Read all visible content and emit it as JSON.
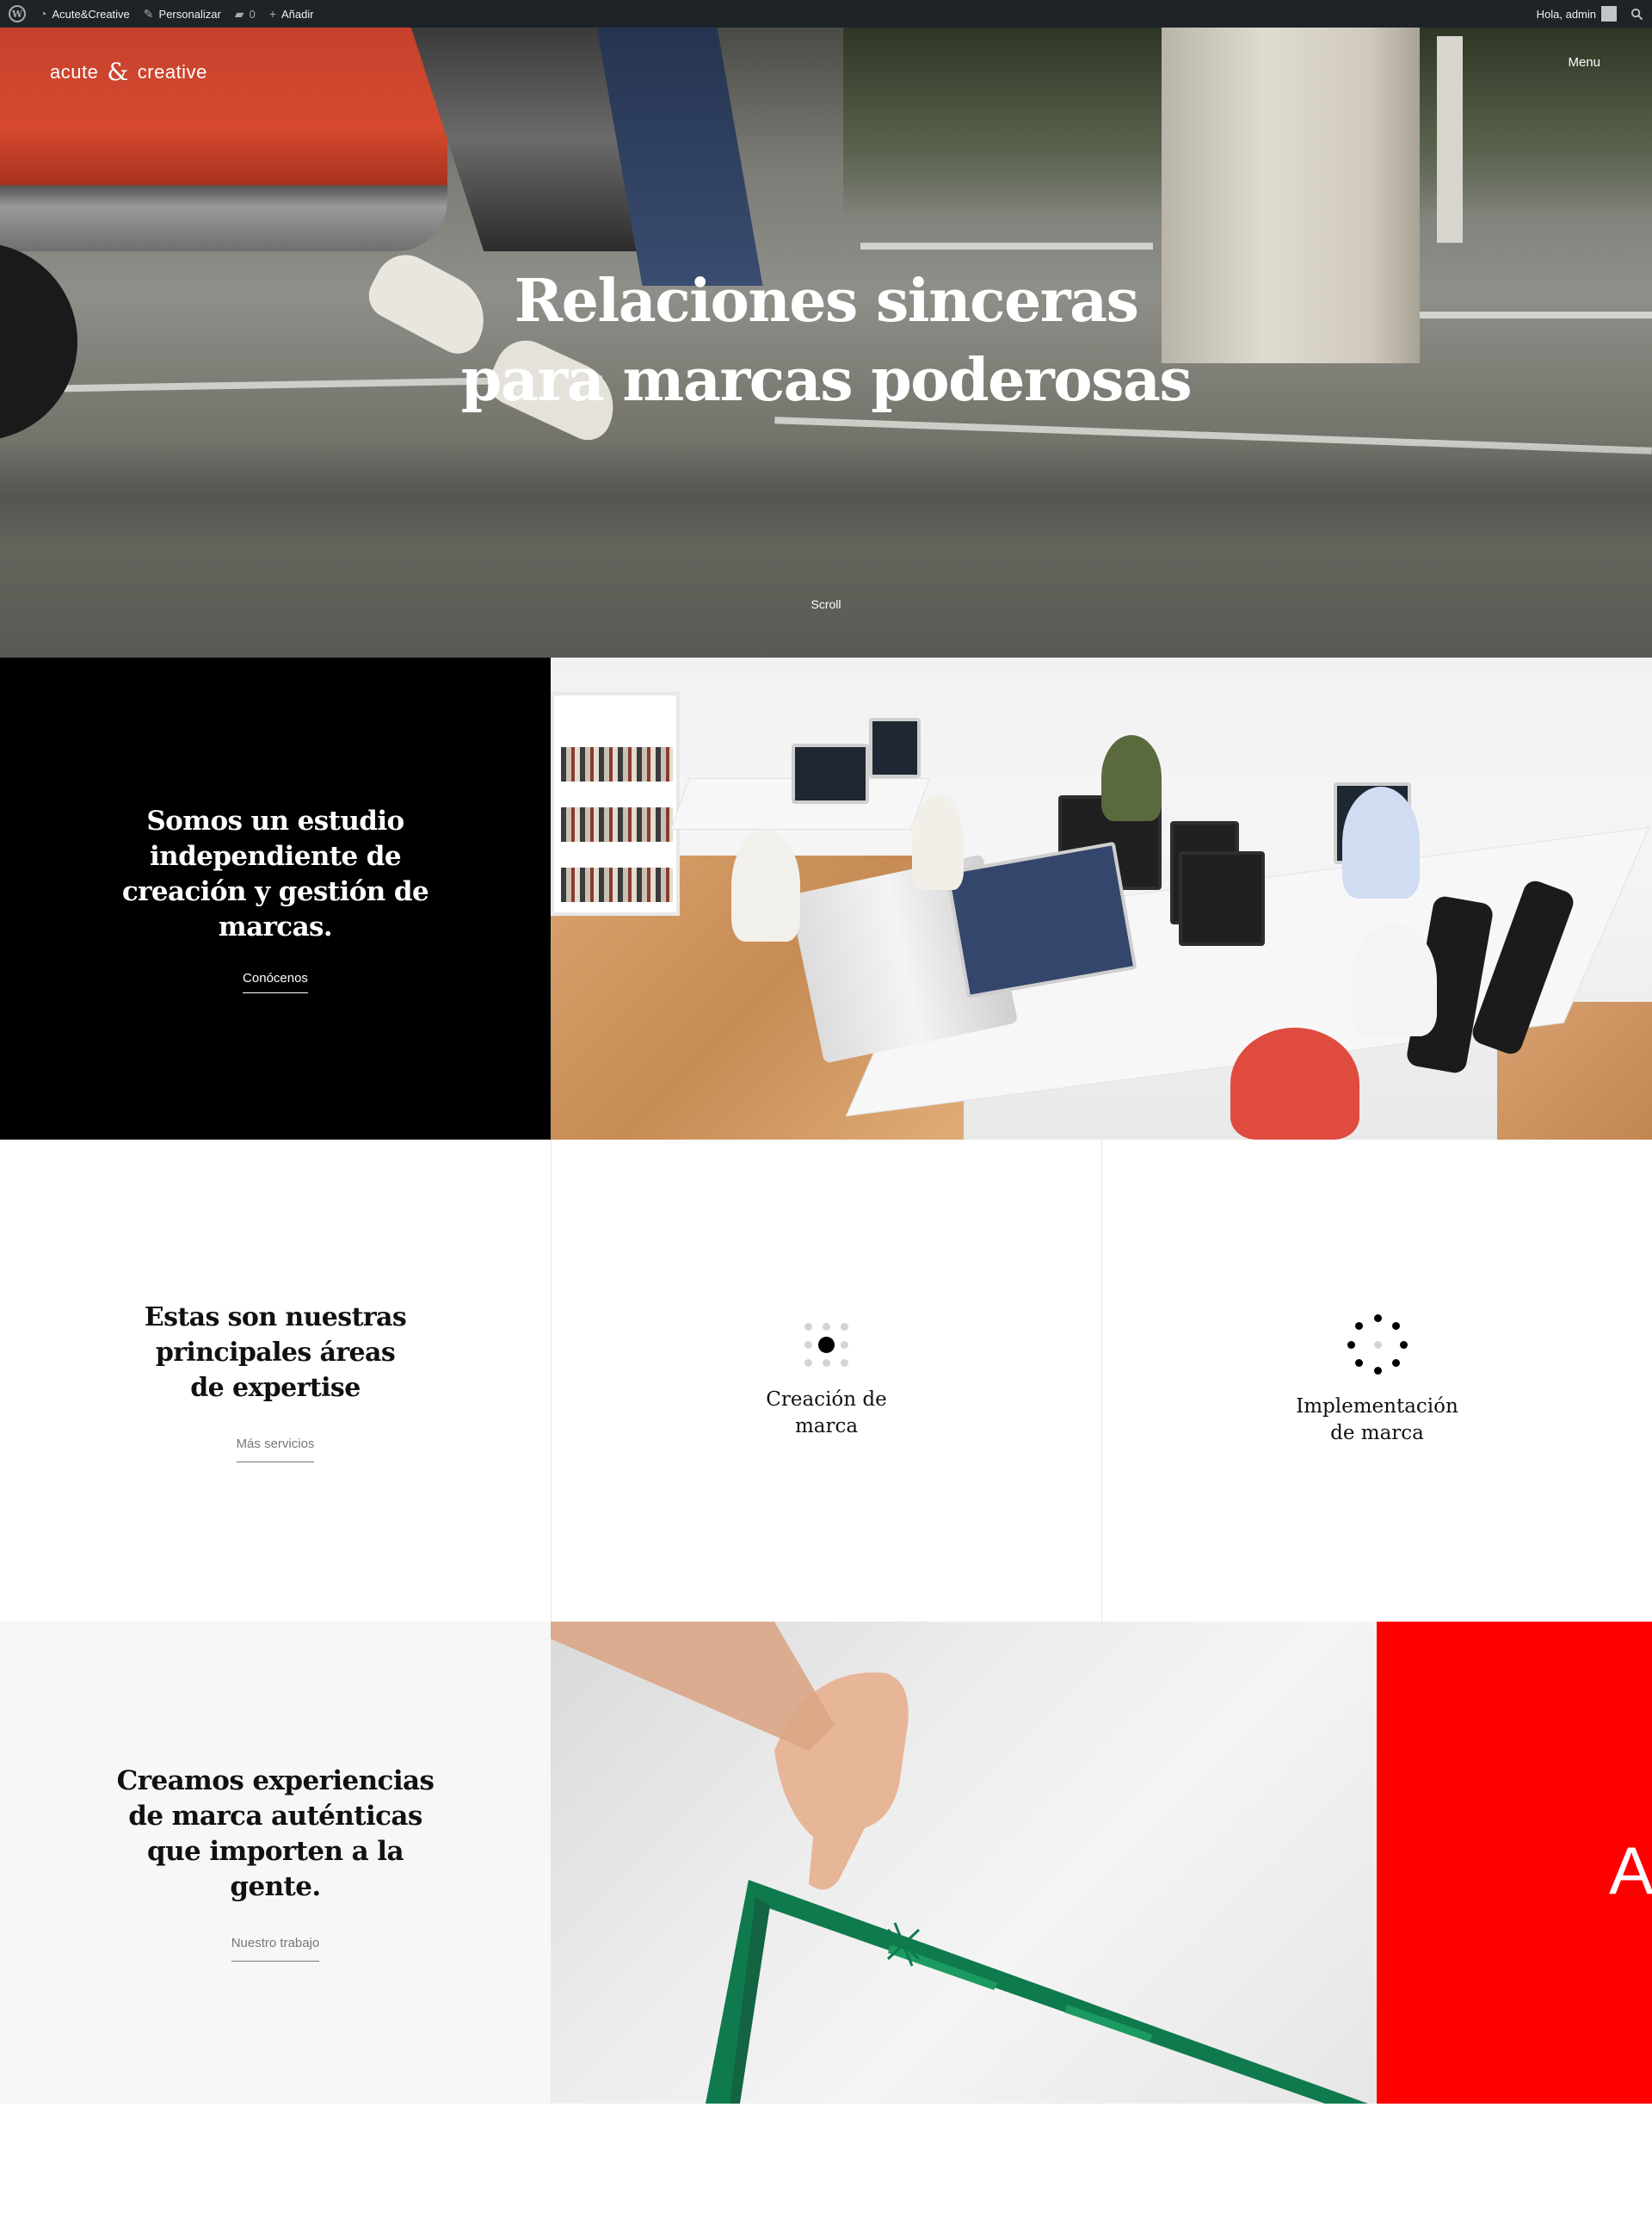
{
  "adminbar": {
    "site_name": "Acute&Creative",
    "customize": "Personalizar",
    "comments_count": "0",
    "add_new": "Añadir",
    "greeting": "Hola, admin"
  },
  "header": {
    "logo_left": "acute",
    "logo_amp": "&",
    "logo_right": "creative",
    "menu": "Menu"
  },
  "hero": {
    "title_line1": "Relaciones sinceras",
    "title_line2": "para marcas poderosas",
    "scroll": "Scroll"
  },
  "intro": {
    "heading": "Somos un estudio independiente de creación y gestión de marcas.",
    "link": "Conócenos"
  },
  "services": {
    "heading": "Estas son nuestras principales áreas de expertise",
    "link": "Más servicios",
    "items": [
      {
        "title": "Creación de marca",
        "icon": "dot-grid-icon"
      },
      {
        "title": "Implementación de marca",
        "icon": "dot-ring-icon"
      }
    ]
  },
  "work": {
    "heading": "Creamos experiencias de marca auténticas que importen a la gente.",
    "link": "Nuestro trabajo",
    "red_mark": "A"
  },
  "colors": {
    "adminbar": "#1d2327",
    "black": "#000000",
    "red_accent": "#ff0000",
    "ribbon_green": "#0f7a4d"
  }
}
